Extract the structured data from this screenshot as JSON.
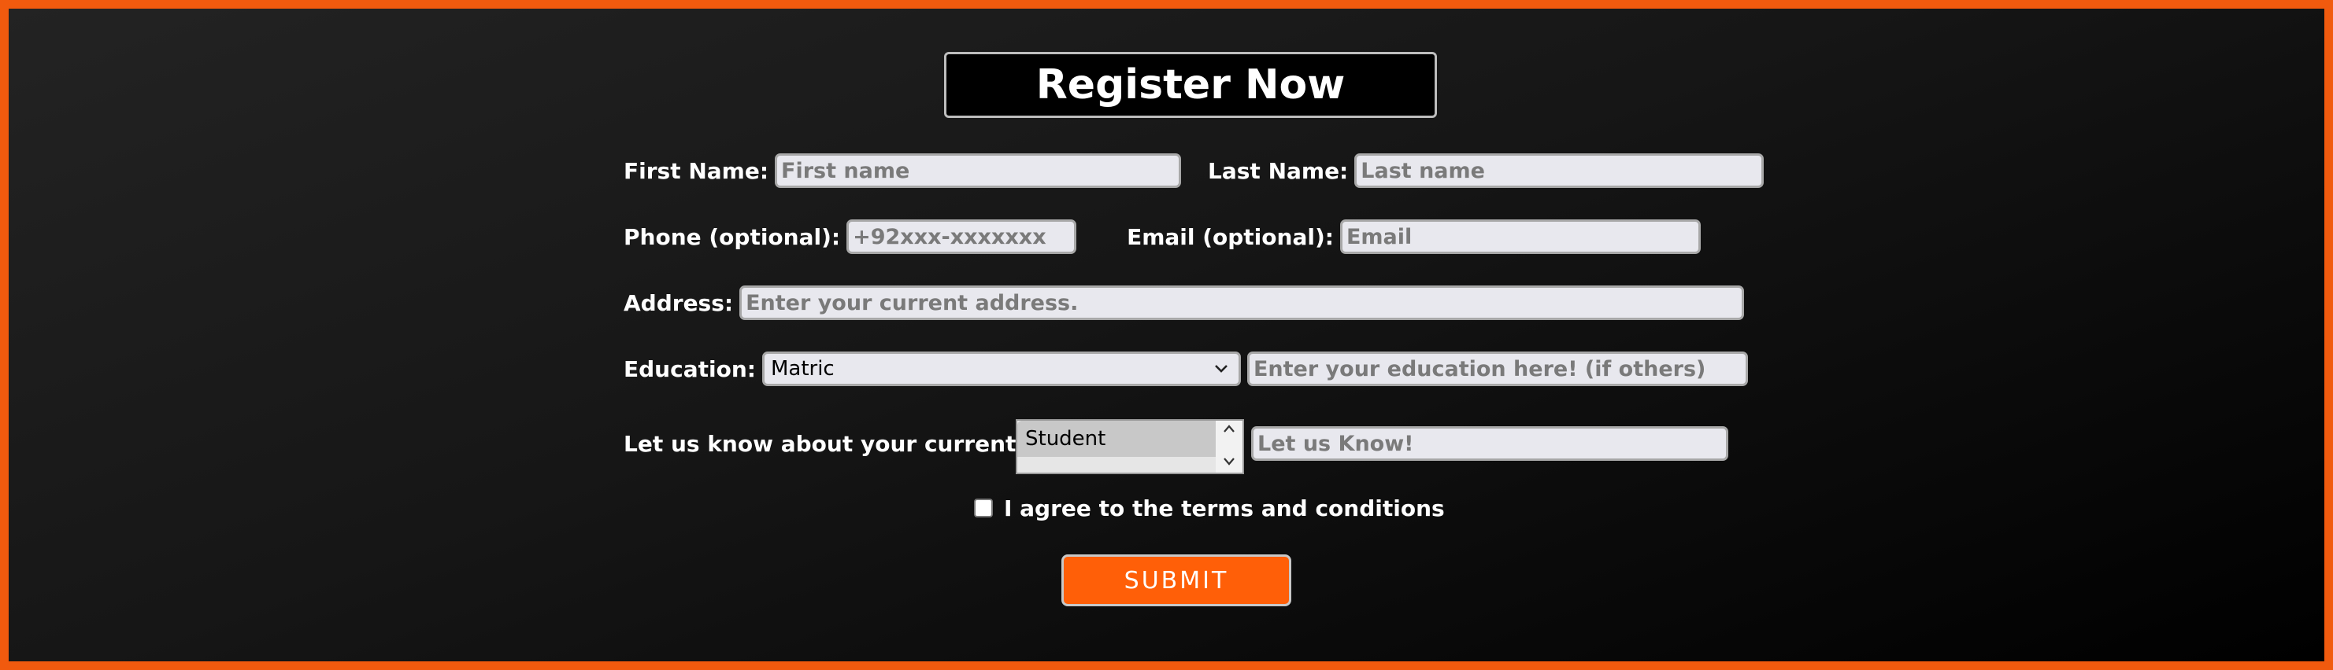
{
  "form": {
    "title": "Register Now",
    "first_name": {
      "label": "First Name:",
      "placeholder": "First name",
      "value": ""
    },
    "last_name": {
      "label": "Last Name:",
      "placeholder": "Last name",
      "value": ""
    },
    "phone": {
      "label": "Phone (optional):",
      "placeholder": "+92xxx-xxxxxxx",
      "value": ""
    },
    "email": {
      "label": "Email (optional):",
      "placeholder": "Email",
      "value": ""
    },
    "address": {
      "label": "Address:",
      "placeholder": "Enter your current address.",
      "value": ""
    },
    "education": {
      "label": "Education:",
      "selected": "Matric",
      "other_placeholder": "Enter your education here! (if others)"
    },
    "job": {
      "label": "Let us know about your current job.",
      "selected": "Student",
      "other_placeholder": "Let us Know!"
    },
    "terms": {
      "label": "I agree to the terms and conditions",
      "checked": false
    },
    "submit_label": "SUBMIT"
  },
  "icons": {
    "education_dropdown": "chevron-down-icon",
    "job_scroll_up": "chevron-up-icon",
    "job_scroll_down": "chevron-down-icon"
  },
  "colors": {
    "accent": "#f15a0e",
    "submit_bg": "#ff5f08",
    "background_dark": "#000000",
    "input_bg": "#e8e8ee"
  }
}
